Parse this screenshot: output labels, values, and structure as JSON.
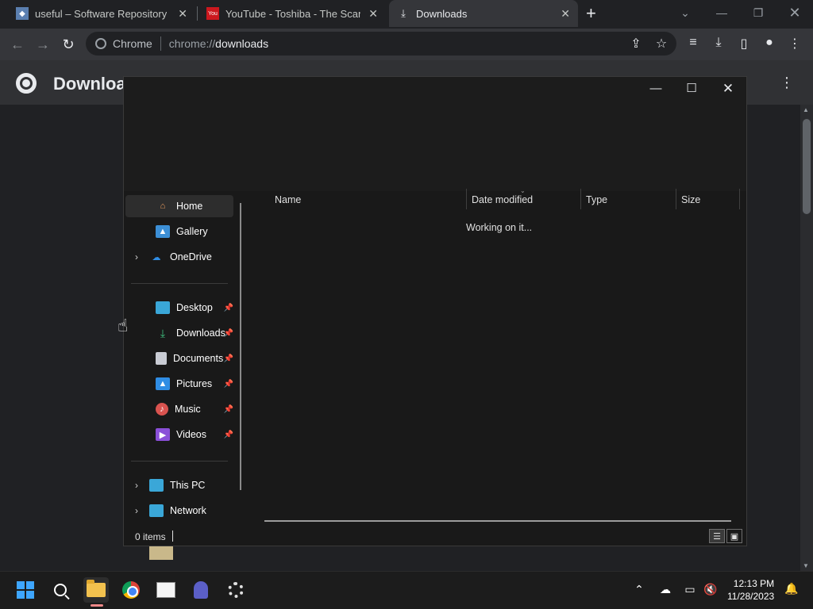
{
  "browser": {
    "tabs": [
      {
        "title": "useful – Software Repository",
        "icon": "repo-favicon"
      },
      {
        "title": "YouTube - Toshiba - The Scandal",
        "icon": "youtube-favicon"
      },
      {
        "title": "Downloads",
        "icon": "download-icon",
        "active": true
      }
    ],
    "omnibox": {
      "chip": "Chrome",
      "scheme": "chrome://",
      "path": "downloads"
    },
    "page_title": "Downloads"
  },
  "dialog": {
    "nav": {
      "quick": [
        {
          "label": "Home",
          "selected": true
        },
        {
          "label": "Gallery"
        },
        {
          "label": "OneDrive",
          "expandable": true
        }
      ],
      "pinned": [
        {
          "label": "Desktop"
        },
        {
          "label": "Downloads"
        },
        {
          "label": "Documents"
        },
        {
          "label": "Pictures"
        },
        {
          "label": "Music"
        },
        {
          "label": "Videos"
        }
      ],
      "devices": [
        {
          "label": "This PC",
          "expandable": true
        },
        {
          "label": "Network",
          "expandable": true
        }
      ]
    },
    "columns": [
      "Name",
      "Date modified",
      "Type",
      "Size"
    ],
    "status_message": "Working on it...",
    "item_count": "0 items"
  },
  "taskbar": {
    "time": "12:13 PM",
    "date": "11/28/2023"
  },
  "colors": {
    "accent": "#3ea6ff",
    "dialog_bg": "#191919",
    "selected_nav": "#2d2d2d"
  }
}
